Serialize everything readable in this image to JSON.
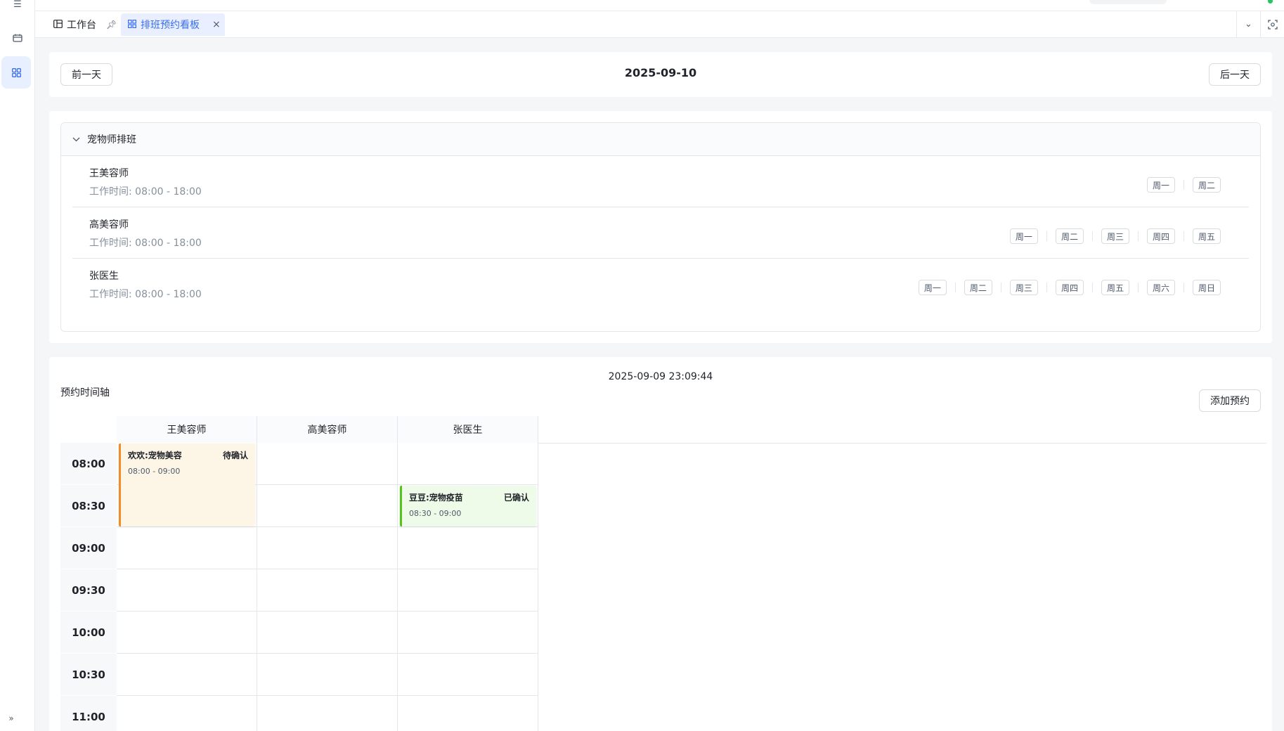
{
  "tabs": [
    {
      "label": "工作台",
      "icon": "layout-icon"
    },
    {
      "label": "排班预约看板",
      "icon": "grid-icon"
    }
  ],
  "day_nav": {
    "prev_label": "前一天",
    "next_label": "后一天",
    "date": "2025-09-10"
  },
  "schedule": {
    "title": "宠物师排班",
    "staff": [
      {
        "name": "王美容师",
        "hours": "工作时间: 08:00 - 18:00",
        "days": [
          "周一",
          "周二"
        ]
      },
      {
        "name": "高美容师",
        "hours": "工作时间: 08:00 - 18:00",
        "days": [
          "周一",
          "周二",
          "周三",
          "周四",
          "周五"
        ]
      },
      {
        "name": "张医生",
        "hours": "工作时间: 08:00 - 18:00",
        "days": [
          "周一",
          "周二",
          "周三",
          "周四",
          "周五",
          "周六",
          "周日"
        ]
      }
    ]
  },
  "timeline": {
    "title": "预约时间轴",
    "clock": "2025-09-09 23:09:44",
    "add_label": "添加预约",
    "columns": [
      "王美容师",
      "高美容师",
      "张医生"
    ],
    "times": [
      "08:00",
      "08:30",
      "09:00",
      "09:30",
      "10:00",
      "10:30",
      "11:00"
    ],
    "appointments": [
      {
        "staff_index": 0,
        "slot_start": 0,
        "slots": 2,
        "title": "欢欢:宠物美容",
        "time": "08:00 - 09:00",
        "status": "待确认",
        "status_color": "#f08c2a"
      },
      {
        "staff_index": 2,
        "slot_start": 1,
        "slots": 1,
        "title": "豆豆:宠物疫苗",
        "time": "08:30 - 09:00",
        "status": "已确认",
        "status_color": "#52c41a"
      }
    ]
  }
}
